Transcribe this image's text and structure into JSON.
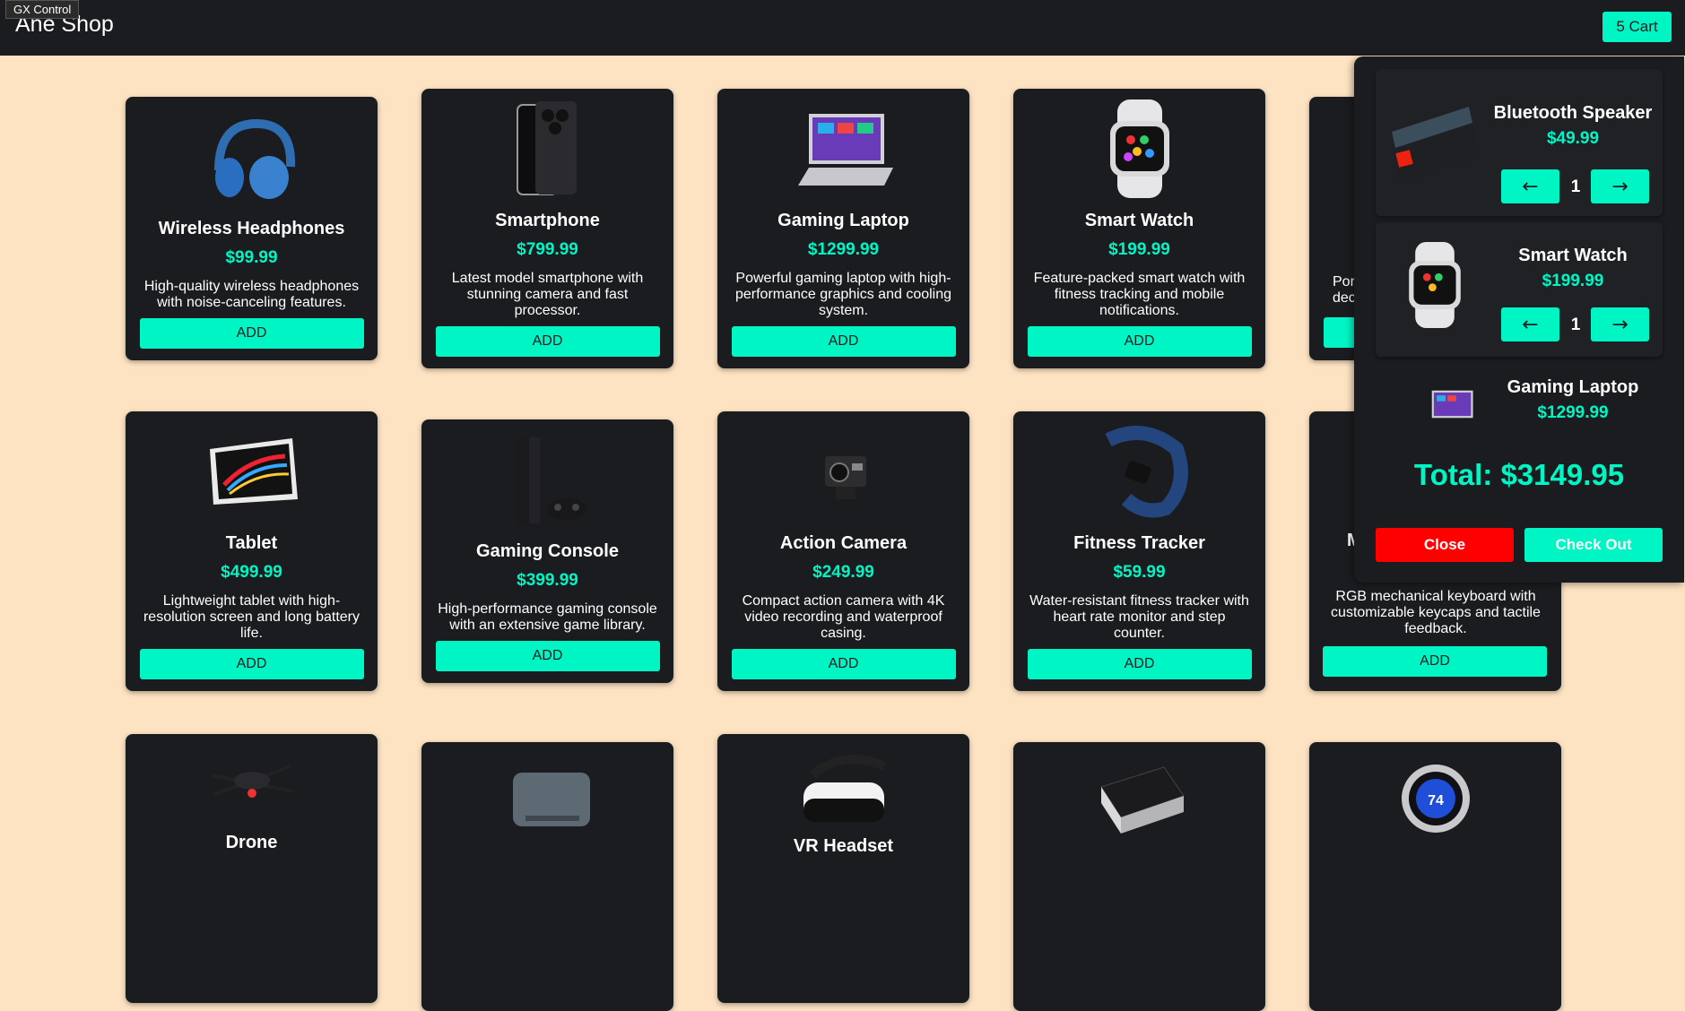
{
  "header": {
    "brand": "Ane Shop",
    "cart_label": "5 Cart",
    "gx_label": "GX Control"
  },
  "products": [
    {
      "title": "Wireless Headphones",
      "price": "$99.99",
      "desc": "High-quality wireless headphones with noise-canceling features.",
      "add": "ADD",
      "icon": "headphones-icon"
    },
    {
      "title": "Smartphone",
      "price": "$799.99",
      "desc": "Latest model smartphone with stunning camera and fast processor.",
      "add": "ADD",
      "icon": "smartphone-icon"
    },
    {
      "title": "Gaming Laptop",
      "price": "$1299.99",
      "desc": "Powerful gaming laptop with high-performance graphics and cooling system.",
      "add": "ADD",
      "icon": "laptop-icon"
    },
    {
      "title": "Smart Watch",
      "price": "$199.99",
      "desc": "Feature-packed smart watch with fitness tracking and mobile notifications.",
      "add": "ADD",
      "icon": "watch-icon"
    },
    {
      "title": "Tablet",
      "price": "$499.99",
      "desc": "Lightweight tablet with high-resolution screen and long battery life.",
      "add": "ADD",
      "icon": "tablet-icon"
    },
    {
      "title": "Gaming Console",
      "price": "$399.99",
      "desc": "High-performance gaming console with an extensive game library.",
      "add": "ADD",
      "icon": "console-icon"
    },
    {
      "title": "Action Camera",
      "price": "$249.99",
      "desc": "Compact action camera with 4K video recording and waterproof casing.",
      "add": "ADD",
      "icon": "camera-icon"
    },
    {
      "title": "Fitness Tracker",
      "price": "$59.99",
      "desc": "Water-resistant fitness tracker with heart rate monitor and step counter.",
      "add": "ADD",
      "icon": "fitness-tracker-icon"
    },
    {
      "title": "M",
      "price": "",
      "desc": "RGB mechanical keyboard with customizable keycaps and tactile feedback.",
      "add": "ADD",
      "icon": "keyboard-icon"
    }
  ],
  "partial_card": {
    "desc_line1": "Por",
    "desc_line2": "dec"
  },
  "bottom_row": [
    {
      "title": "Drone",
      "icon": "drone-icon"
    },
    {
      "title": "",
      "icon": "hard-drive-icon"
    },
    {
      "title": "VR Headset",
      "icon": "vr-headset-icon"
    },
    {
      "title": "",
      "icon": "power-bank-icon"
    },
    {
      "title": "",
      "icon": "thermostat-icon"
    }
  ],
  "cart": {
    "items": [
      {
        "name": "Bluetooth Speaker",
        "price": "$49.99",
        "qty": "1",
        "icon": "speaker-icon"
      },
      {
        "name": "Smart Watch",
        "price": "$199.99",
        "qty": "1",
        "icon": "watch-icon"
      },
      {
        "name": "Gaming Laptop",
        "price": "$1299.99",
        "qty": "",
        "icon": "laptop-icon"
      }
    ],
    "dec_label": "←",
    "inc_label": "→",
    "total": "Total: $3149.95",
    "close_label": "Close",
    "checkout_label": "Check Out"
  },
  "colors": {
    "accent": "#00f5c4",
    "background": "#fde3c2",
    "card": "#1b1c1f",
    "danger": "#ff0000"
  }
}
